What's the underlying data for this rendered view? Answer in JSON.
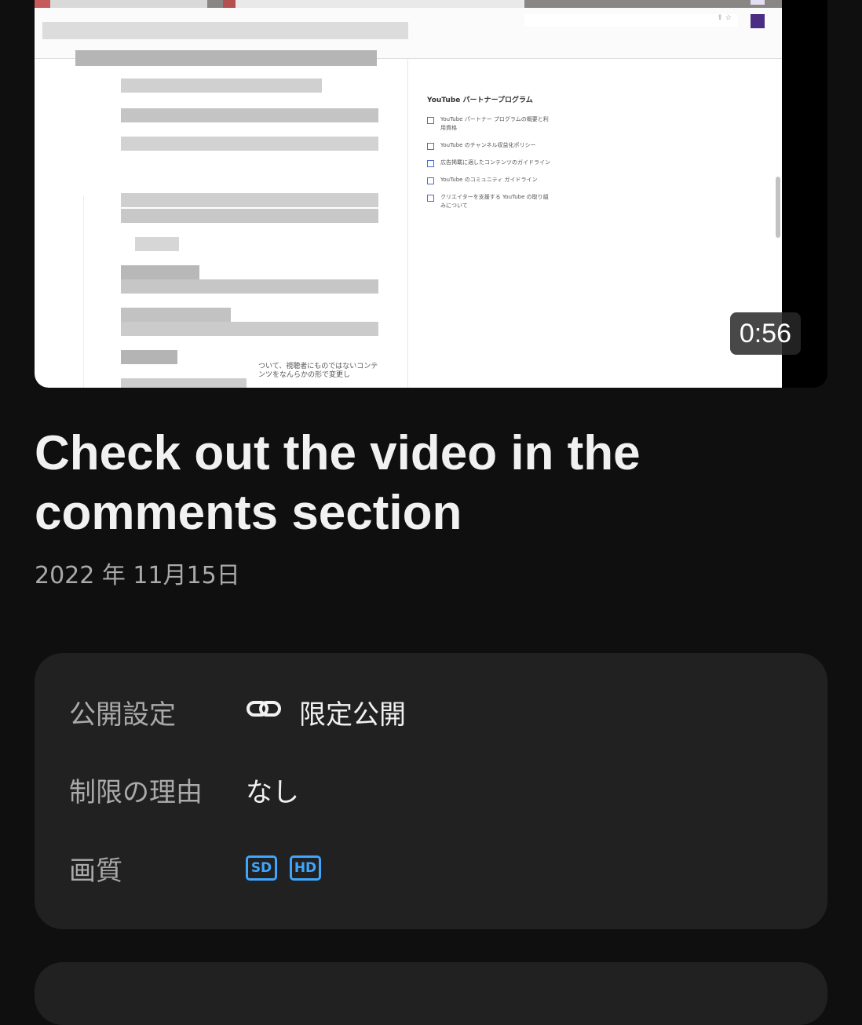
{
  "video": {
    "duration": "0:56",
    "embedded_panel": {
      "title": "YouTube パートナープログラム",
      "items": [
        "YouTube パートナー プログラムの概要と利用資格",
        "YouTube のチャンネル収益化ポリシー",
        "広告掲載に適したコンテンツのガイドライン",
        "YouTube のコミュニティ ガイドライン",
        "クリエイターを支援する YouTube の取り組みについて"
      ],
      "bottom_text": "ついて、視聴者にものではないコンテンツをなんらかの形で変更し"
    }
  },
  "title": "Check out the video in the comments section",
  "date": "2022 年 11月15日",
  "details": {
    "visibility": {
      "label": "公開設定",
      "icon": "link-icon",
      "value": "限定公開"
    },
    "restriction": {
      "label": "制限の理由",
      "value": "なし"
    },
    "quality": {
      "label": "画質",
      "badges": [
        "SD",
        "HD"
      ],
      "badge_color": "#3ea6ff"
    }
  }
}
